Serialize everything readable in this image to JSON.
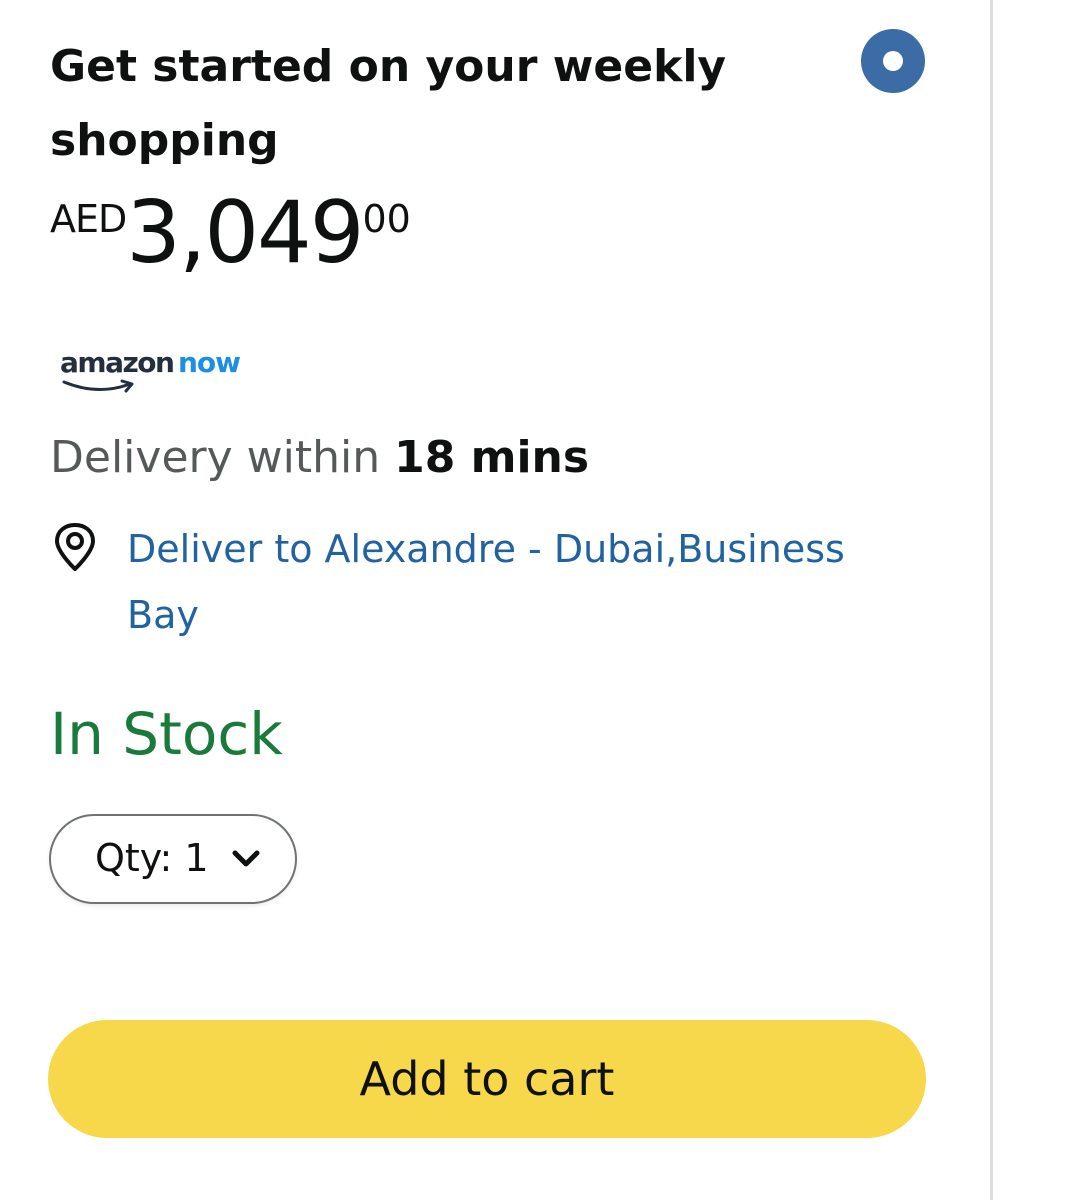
{
  "offer": {
    "title": "Get started on your weekly shopping",
    "selected": true
  },
  "price": {
    "currency": "AED",
    "whole": "3,049",
    "fraction": "00"
  },
  "brand": {
    "logo_text_main": "amazon",
    "logo_text_accent": "now",
    "accent_color": "#1a8fe3"
  },
  "delivery": {
    "prefix": "Delivery within ",
    "time": "18 mins",
    "address_label": "Deliver to Alexandre - Dubai,Business Bay",
    "icon": "location-pin-icon"
  },
  "availability": {
    "status": "In Stock",
    "status_color": "#197a3c"
  },
  "quantity": {
    "label": "Qty: 1",
    "icon": "chevron-down-icon"
  },
  "actions": {
    "add_to_cart_label": "Add to cart",
    "add_to_cart_color": "#f6d84a"
  }
}
